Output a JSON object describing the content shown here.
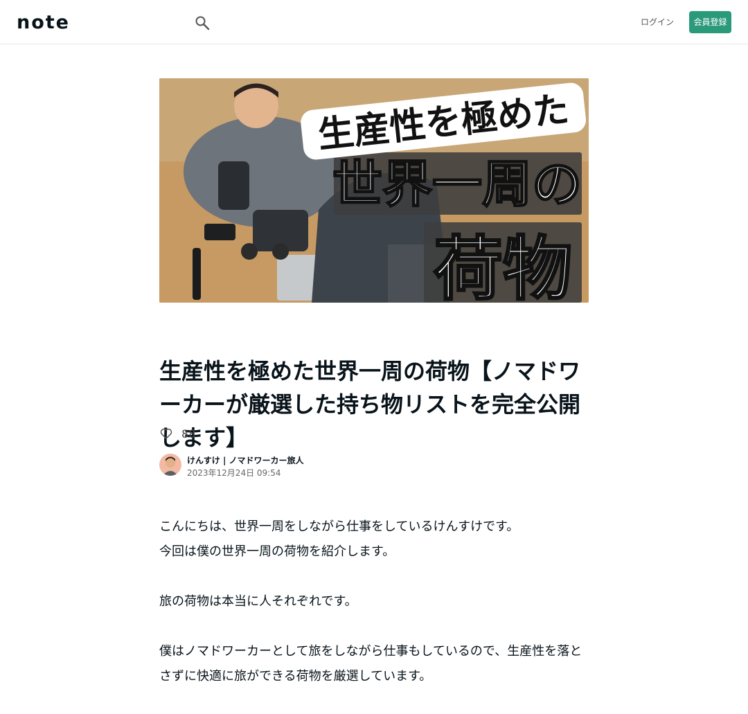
{
  "header": {
    "logo_text": "note",
    "login_label": "ログイン",
    "signup_label": "会員登録"
  },
  "hero": {
    "caption_line1": "生産性を極めた",
    "caption_line2": "世界一周の",
    "caption_line3": "荷物"
  },
  "article": {
    "title": "生産性を極めた世界一周の荷物【ノマドワーカーが厳選した持ち物リストを完全公開します】",
    "like_count": "88",
    "author_name": "けんすけ | ノマドワーカー旅人",
    "date": "2023年12月24日 09:54",
    "paragraphs": [
      "こんにちは、世界一周をしながら仕事をしているけんすけです。\n今回は僕の世界一周の荷物を紹介します。",
      "旅の荷物は本当に人それぞれです。",
      "僕はノマドワーカーとして旅をしながら仕事もしているので、生産性を落とさずに快適に旅ができる荷物を厳選しています。"
    ]
  },
  "colors": {
    "accent": "#2b9a7a",
    "text": "#08131a"
  },
  "icons": {
    "search": "search-icon",
    "like": "heart-icon"
  }
}
